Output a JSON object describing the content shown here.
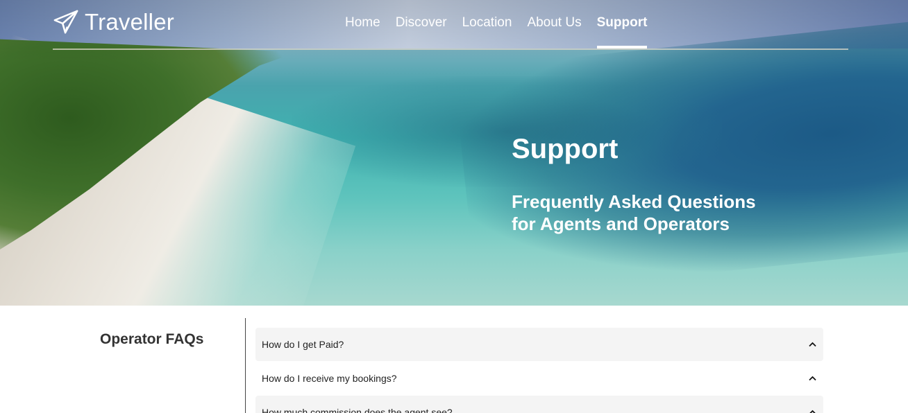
{
  "brand": {
    "name": "Traveller",
    "logo_icon": "paper-plane-icon"
  },
  "nav": {
    "items": [
      {
        "label": "Home"
      },
      {
        "label": "Discover"
      },
      {
        "label": "Location"
      },
      {
        "label": "About Us"
      },
      {
        "label": "Support",
        "active": true
      }
    ]
  },
  "hero": {
    "title": "Support",
    "subtitle_line1": "Frequently Asked Questions",
    "subtitle_line2": "for Agents and Operators"
  },
  "faq": {
    "heading": "Operator FAQs",
    "items": [
      {
        "question": "How do I get Paid?",
        "icon": "chevron-up-icon"
      },
      {
        "question": "How do I receive my bookings?",
        "icon": "chevron-up-icon"
      },
      {
        "question": "How much commission does the agent see?",
        "icon": "chevron-up-icon"
      }
    ]
  },
  "colors": {
    "nav_text": "#ffffff",
    "faq_row_bg": "#f4f4f4",
    "heading_text": "#333333"
  }
}
